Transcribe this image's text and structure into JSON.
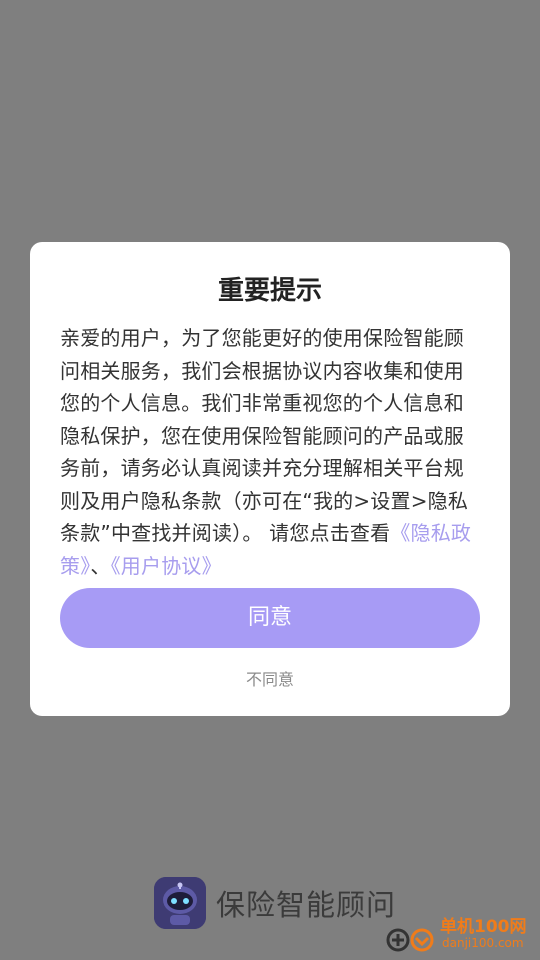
{
  "dialog": {
    "title": "重要提示",
    "body_text": "亲爱的用户，为了您能更好的使用保险智能顾问相关服务，我们会根据协议内容收集和使用您的个人信息。我们非常重视您的个人信息和隐私保护，您在使用保险智能顾问的产品或服务前，请务必认真阅读并充分理解相关平台规则及用户隐私条款（亦可在“我的>设置>隐私条款”中查找并阅读）。 请您点击查看",
    "privacy_link": "《隐私政策》",
    "separator": "、",
    "user_agreement_link": "《用户协议》",
    "agree_label": "同意",
    "disagree_label": "不同意"
  },
  "brand": {
    "name": "保险智能顾问",
    "logo_icon": "robot-icon"
  },
  "watermark": {
    "title": "单机100网",
    "url": "danji100.com"
  },
  "colors": {
    "accent": "#a79bf5",
    "link": "#a79dee",
    "overlay": "#7f7f7f",
    "watermark": "#f07c1a"
  }
}
